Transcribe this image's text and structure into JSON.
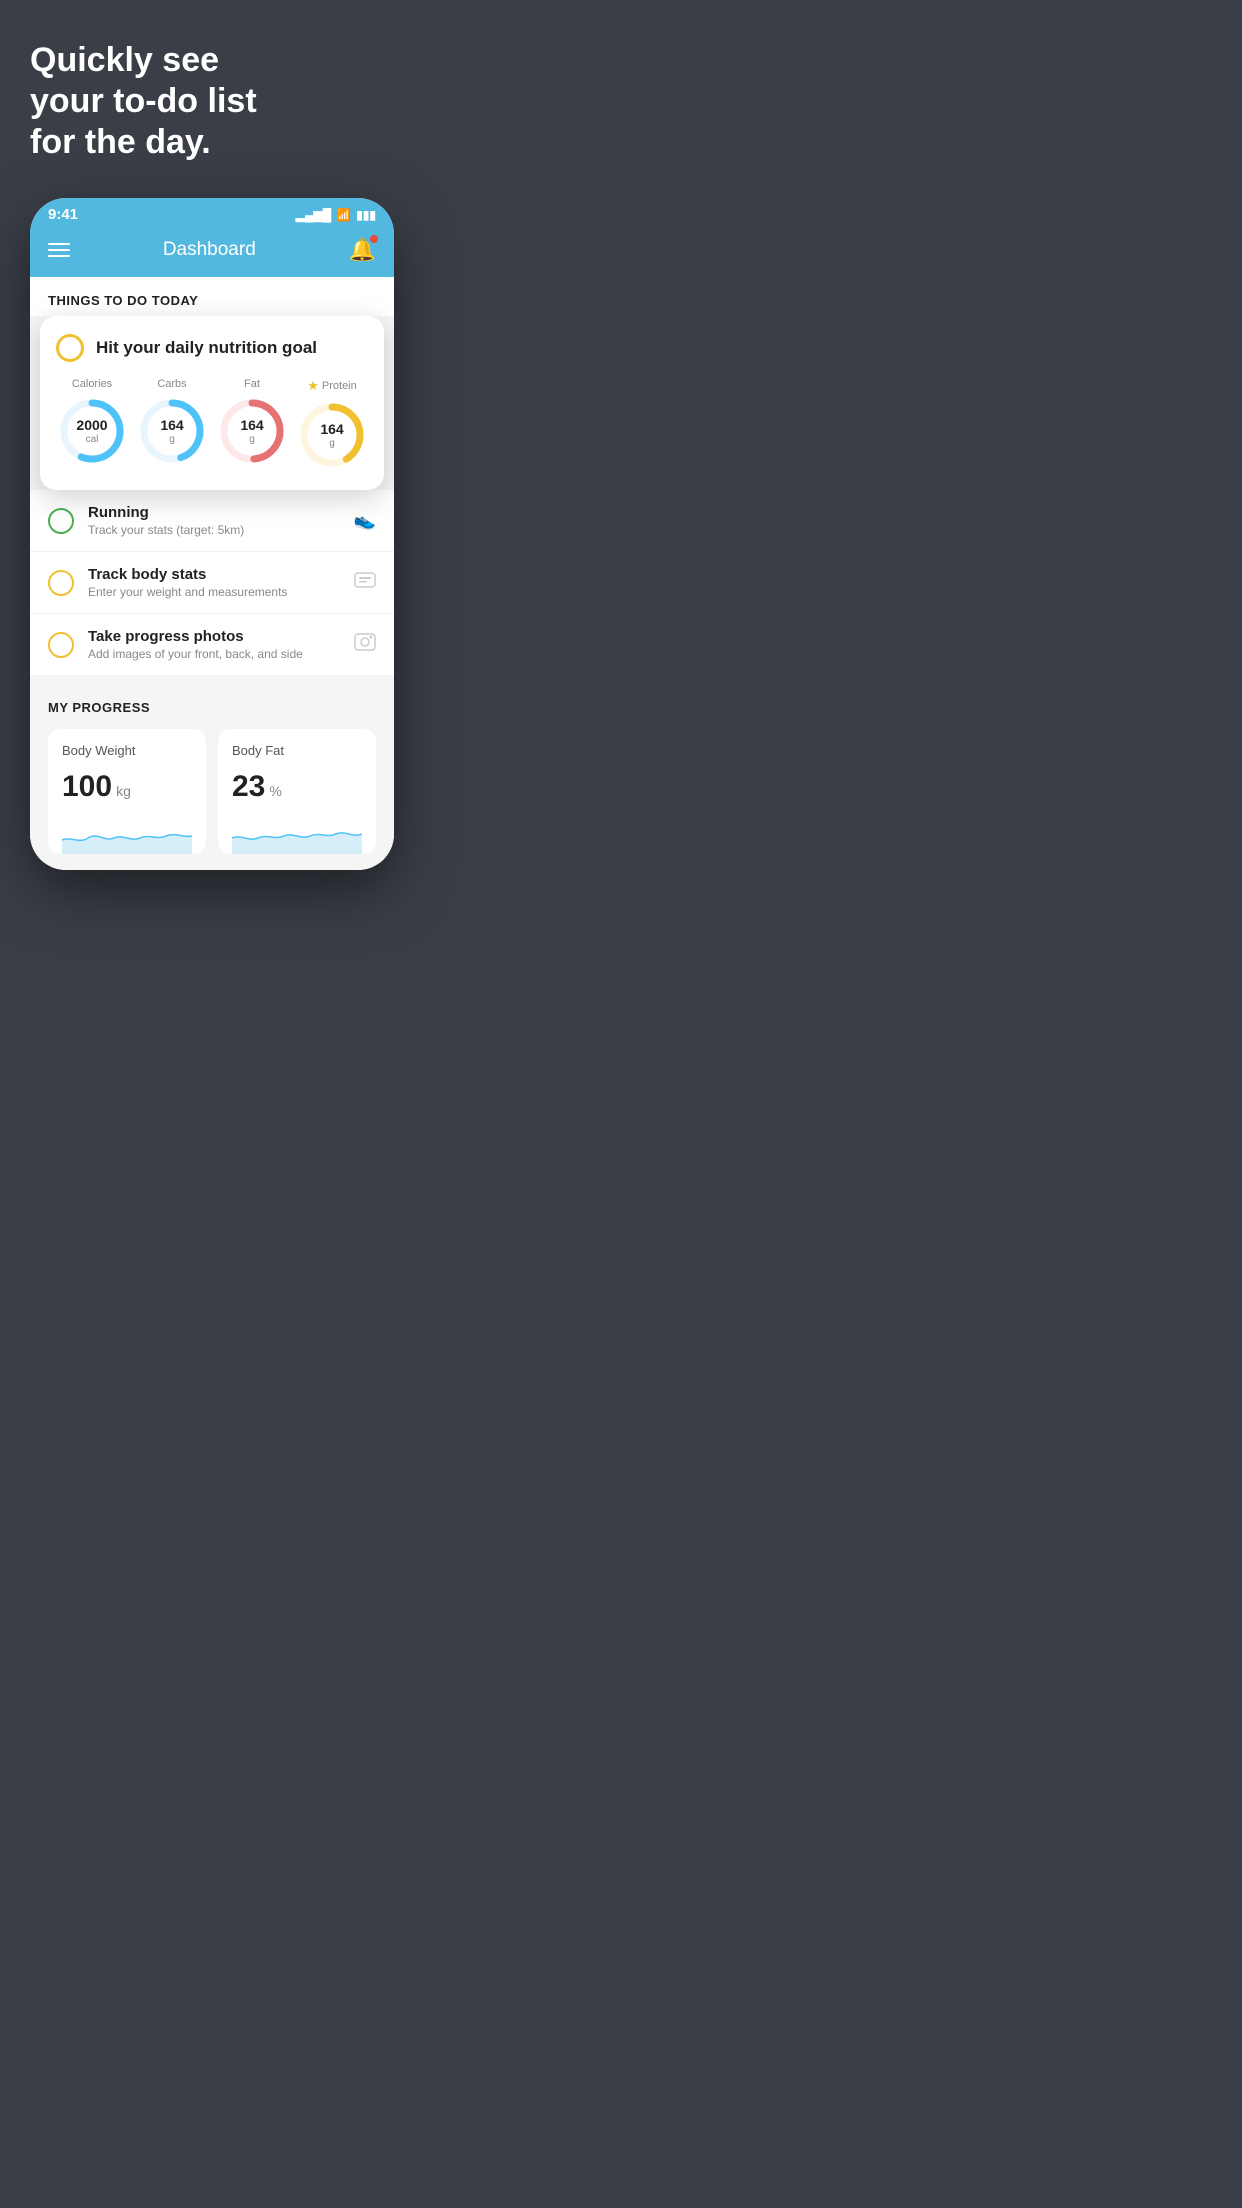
{
  "headline": {
    "line1": "Quickly see",
    "line2": "your to-do list",
    "line3": "for the day."
  },
  "phone": {
    "status_bar": {
      "time": "9:41",
      "signal": "▂▄▆█",
      "wifi": "wifi",
      "battery": "battery"
    },
    "nav": {
      "title": "Dashboard"
    },
    "things_header": "THINGS TO DO TODAY",
    "float_card": {
      "title": "Hit your daily nutrition goal",
      "items": [
        {
          "label": "Calories",
          "value": "2000",
          "unit": "cal",
          "color": "#4fc3f7",
          "track": 75,
          "star": false
        },
        {
          "label": "Carbs",
          "value": "164",
          "unit": "g",
          "color": "#4fc3f7",
          "track": 60,
          "star": false
        },
        {
          "label": "Fat",
          "value": "164",
          "unit": "g",
          "color": "#e57373",
          "track": 65,
          "star": false
        },
        {
          "label": "Protein",
          "value": "164",
          "unit": "g",
          "color": "#f0c030",
          "track": 55,
          "star": true
        }
      ]
    },
    "todo_items": [
      {
        "name": "Running",
        "sub": "Track your stats (target: 5km)",
        "circle": "green",
        "icon": "👟"
      },
      {
        "name": "Track body stats",
        "sub": "Enter your weight and measurements",
        "circle": "yellow",
        "icon": "⚖️"
      },
      {
        "name": "Take progress photos",
        "sub": "Add images of your front, back, and side",
        "circle": "yellow",
        "icon": "🖼️"
      }
    ],
    "progress": {
      "header": "MY PROGRESS",
      "cards": [
        {
          "title": "Body Weight",
          "value": "100",
          "unit": "kg"
        },
        {
          "title": "Body Fat",
          "value": "23",
          "unit": "%"
        }
      ]
    }
  }
}
